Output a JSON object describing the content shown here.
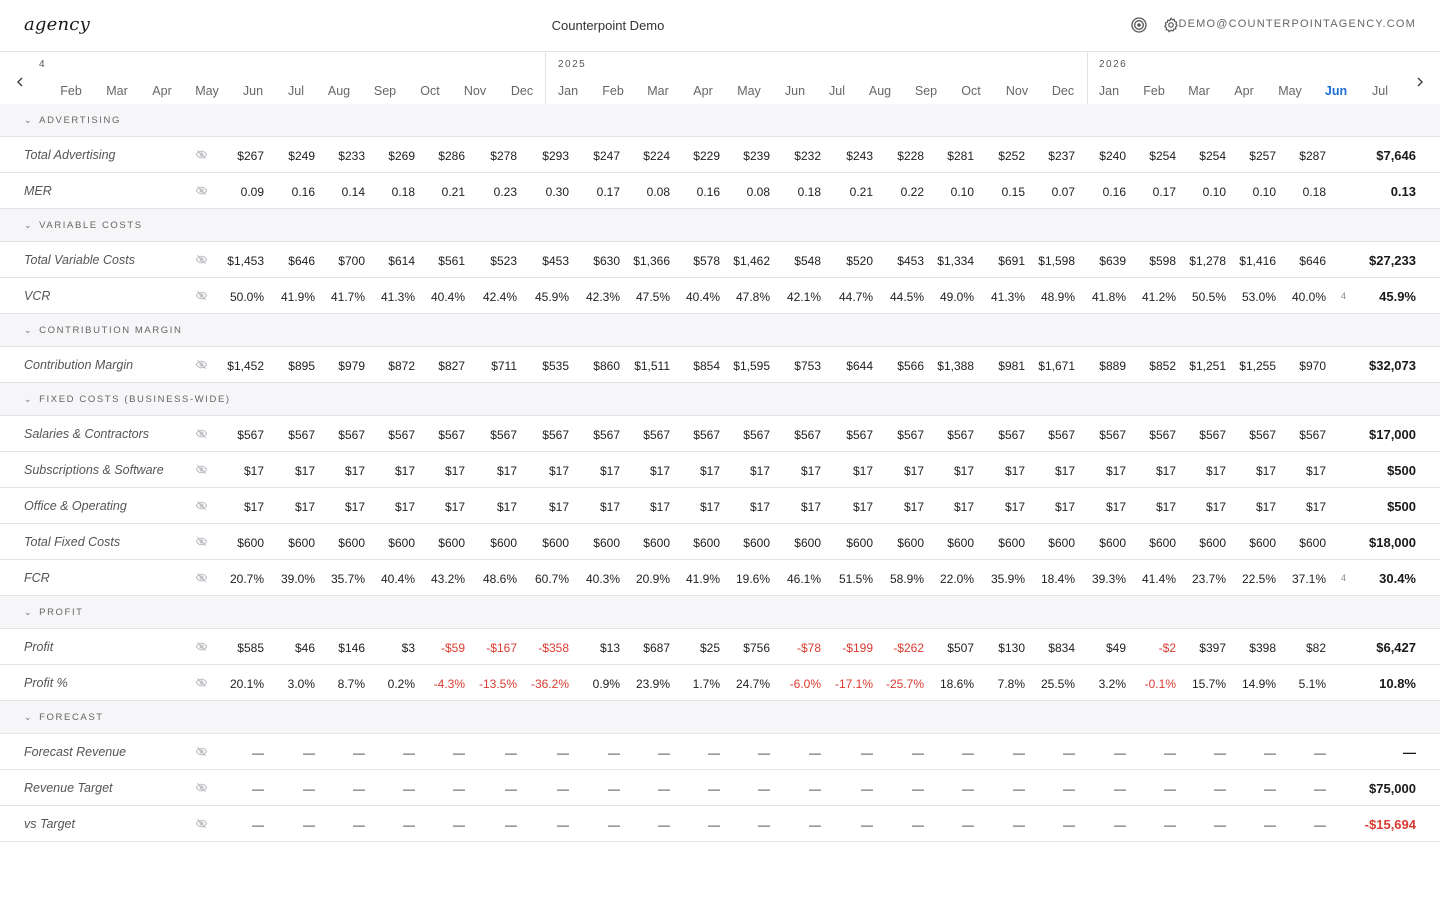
{
  "app": {
    "logo": "agency",
    "title": "Counterpoint Demo",
    "icons": [
      "target-icon",
      "gear-icon"
    ],
    "user_email": "DEMO@COUNTERPOINTAGENCY.COM"
  },
  "colors": {
    "accent": "#1d6fd6",
    "negative": "#d93b30",
    "section_bg": "#f6f6f8",
    "border": "#e3e3e6"
  },
  "timeline": {
    "prev_year_fragment": "4",
    "years": [
      "2025",
      "2026"
    ],
    "months": [
      "Feb",
      "Mar",
      "Apr",
      "May",
      "Jun",
      "Jul",
      "Aug",
      "Sep",
      "Oct",
      "Nov",
      "Dec",
      "Jan",
      "Feb",
      "Mar",
      "Apr",
      "May",
      "Jun",
      "Jul",
      "Aug",
      "Sep",
      "Oct",
      "Nov",
      "Dec",
      "Jan",
      "Feb",
      "Mar",
      "Apr",
      "May",
      "Jun",
      "Jul"
    ],
    "active_month_index": 28
  },
  "sections": [
    {
      "label": "ADVERTISING",
      "rows": [
        {
          "label": "Total Advertising",
          "values": [
            "$267",
            "$249",
            "$233",
            "$269",
            "$286",
            "$278",
            "$293",
            "$247",
            "$224",
            "$229",
            "$239",
            "$232",
            "$243",
            "$228",
            "$281",
            "$252",
            "$237",
            "$240",
            "$254",
            "$254",
            "$257",
            "$287"
          ],
          "total": "$7,646"
        },
        {
          "label": "MER",
          "values": [
            "0.09",
            "0.16",
            "0.14",
            "0.18",
            "0.21",
            "0.23",
            "0.30",
            "0.17",
            "0.08",
            "0.16",
            "0.08",
            "0.18",
            "0.21",
            "0.22",
            "0.10",
            "0.15",
            "0.07",
            "0.16",
            "0.17",
            "0.10",
            "0.10",
            "0.18"
          ],
          "total": "0.13"
        }
      ]
    },
    {
      "label": "VARIABLE COSTS",
      "rows": [
        {
          "label": "Total Variable Costs",
          "values": [
            "$1,453",
            "$646",
            "$700",
            "$614",
            "$561",
            "$523",
            "$453",
            "$630",
            "$1,366",
            "$578",
            "$1,462",
            "$548",
            "$520",
            "$453",
            "$1,334",
            "$691",
            "$1,598",
            "$639",
            "$598",
            "$1,278",
            "$1,416",
            "$646"
          ],
          "total": "$27,233"
        },
        {
          "label": "VCR",
          "values": [
            "50.0%",
            "41.9%",
            "41.7%",
            "41.3%",
            "40.4%",
            "42.4%",
            "45.9%",
            "42.3%",
            "47.5%",
            "40.4%",
            "47.8%",
            "42.1%",
            "44.7%",
            "44.5%",
            "49.0%",
            "41.3%",
            "48.9%",
            "41.8%",
            "41.2%",
            "50.5%",
            "53.0%",
            "40.0%"
          ],
          "total": "45.9%",
          "clipped": "4"
        }
      ]
    },
    {
      "label": "CONTRIBUTION MARGIN",
      "rows": [
        {
          "label": "Contribution Margin",
          "values": [
            "$1,452",
            "$895",
            "$979",
            "$872",
            "$827",
            "$711",
            "$535",
            "$860",
            "$1,511",
            "$854",
            "$1,595",
            "$753",
            "$644",
            "$566",
            "$1,388",
            "$981",
            "$1,671",
            "$889",
            "$852",
            "$1,251",
            "$1,255",
            "$970"
          ],
          "total": "$32,073"
        }
      ]
    },
    {
      "label": "FIXED COSTS (BUSINESS-WIDE)",
      "rows": [
        {
          "label": "Salaries & Contractors",
          "values": [
            "$567",
            "$567",
            "$567",
            "$567",
            "$567",
            "$567",
            "$567",
            "$567",
            "$567",
            "$567",
            "$567",
            "$567",
            "$567",
            "$567",
            "$567",
            "$567",
            "$567",
            "$567",
            "$567",
            "$567",
            "$567",
            "$567"
          ],
          "total": "$17,000"
        },
        {
          "label": "Subscriptions & Software",
          "values": [
            "$17",
            "$17",
            "$17",
            "$17",
            "$17",
            "$17",
            "$17",
            "$17",
            "$17",
            "$17",
            "$17",
            "$17",
            "$17",
            "$17",
            "$17",
            "$17",
            "$17",
            "$17",
            "$17",
            "$17",
            "$17",
            "$17"
          ],
          "total": "$500"
        },
        {
          "label": "Office & Operating",
          "values": [
            "$17",
            "$17",
            "$17",
            "$17",
            "$17",
            "$17",
            "$17",
            "$17",
            "$17",
            "$17",
            "$17",
            "$17",
            "$17",
            "$17",
            "$17",
            "$17",
            "$17",
            "$17",
            "$17",
            "$17",
            "$17",
            "$17"
          ],
          "total": "$500"
        },
        {
          "label": "Total Fixed Costs",
          "values": [
            "$600",
            "$600",
            "$600",
            "$600",
            "$600",
            "$600",
            "$600",
            "$600",
            "$600",
            "$600",
            "$600",
            "$600",
            "$600",
            "$600",
            "$600",
            "$600",
            "$600",
            "$600",
            "$600",
            "$600",
            "$600",
            "$600"
          ],
          "total": "$18,000"
        },
        {
          "label": "FCR",
          "values": [
            "20.7%",
            "39.0%",
            "35.7%",
            "40.4%",
            "43.2%",
            "48.6%",
            "60.7%",
            "40.3%",
            "20.9%",
            "41.9%",
            "19.6%",
            "46.1%",
            "51.5%",
            "58.9%",
            "22.0%",
            "35.9%",
            "18.4%",
            "39.3%",
            "41.4%",
            "23.7%",
            "22.5%",
            "37.1%"
          ],
          "total": "30.4%",
          "clipped": "4"
        }
      ]
    },
    {
      "label": "PROFIT",
      "rows": [
        {
          "label": "Profit",
          "values": [
            "$585",
            "$46",
            "$146",
            "$3",
            "-$59",
            "-$167",
            "-$358",
            "$13",
            "$687",
            "$25",
            "$756",
            "-$78",
            "-$199",
            "-$262",
            "$507",
            "$130",
            "$834",
            "$49",
            "-$2",
            "$397",
            "$398",
            "$82"
          ],
          "total": "$6,427"
        },
        {
          "label": "Profit %",
          "values": [
            "20.1%",
            "3.0%",
            "8.7%",
            "0.2%",
            "-4.3%",
            "-13.5%",
            "-36.2%",
            "0.9%",
            "23.9%",
            "1.7%",
            "24.7%",
            "-6.0%",
            "-17.1%",
            "-25.7%",
            "18.6%",
            "7.8%",
            "25.5%",
            "3.2%",
            "-0.1%",
            "15.7%",
            "14.9%",
            "5.1%"
          ],
          "total": "10.8%"
        }
      ]
    },
    {
      "label": "FORECAST",
      "rows": [
        {
          "label": "Forecast Revenue",
          "values": [
            "—",
            "—",
            "—",
            "—",
            "—",
            "—",
            "—",
            "—",
            "—",
            "—",
            "—",
            "—",
            "—",
            "—",
            "—",
            "—",
            "—",
            "—",
            "—",
            "—",
            "—",
            "—"
          ],
          "total": "—"
        },
        {
          "label": "Revenue Target",
          "values": [
            "—",
            "—",
            "—",
            "—",
            "—",
            "—",
            "—",
            "—",
            "—",
            "—",
            "—",
            "—",
            "—",
            "—",
            "—",
            "—",
            "—",
            "—",
            "—",
            "—",
            "—",
            "—"
          ],
          "total": "$75,000"
        },
        {
          "label": "vs Target",
          "values": [
            "—",
            "—",
            "—",
            "—",
            "—",
            "—",
            "—",
            "—",
            "—",
            "—",
            "—",
            "—",
            "—",
            "—",
            "—",
            "—",
            "—",
            "—",
            "—",
            "—",
            "—",
            "—"
          ],
          "total": "-$15,694"
        }
      ]
    }
  ]
}
